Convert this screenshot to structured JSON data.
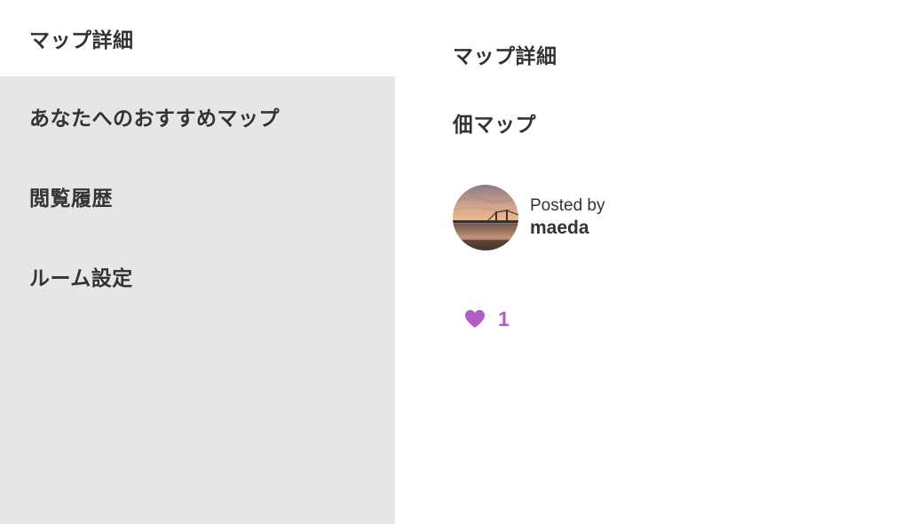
{
  "sidebar": {
    "items": [
      {
        "label": "マップ詳細",
        "active": true
      },
      {
        "label": "あなたへのおすすめマップ",
        "active": false
      },
      {
        "label": "閲覧履歴",
        "active": false
      },
      {
        "label": "ルーム設定",
        "active": false
      }
    ]
  },
  "main": {
    "page_title": "マップ詳細",
    "map_name": "佃マップ",
    "author": {
      "posted_by_label": "Posted by",
      "name": "maeda",
      "avatar_icon": "avatar-photo-sunset-bridge"
    },
    "likes": {
      "icon": "heart-icon",
      "count": "1",
      "color": "#b05cc7"
    }
  },
  "colors": {
    "sidebar_bg": "#e6e6e6",
    "active_item_bg": "#ffffff",
    "text": "#333333",
    "like_accent": "#b05cc7"
  }
}
